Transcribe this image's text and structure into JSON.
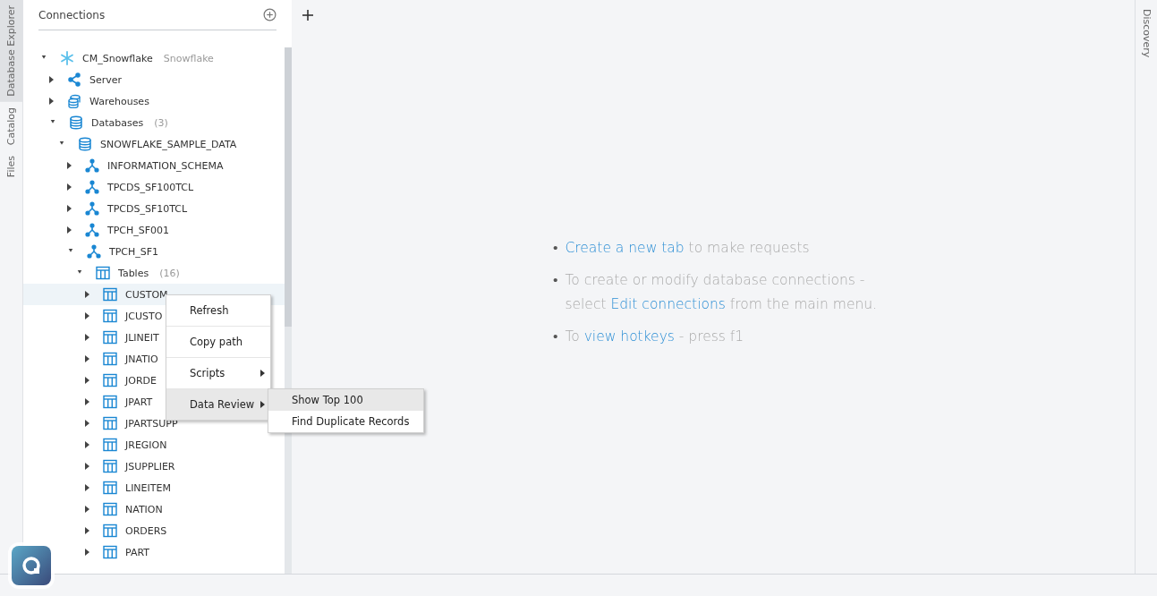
{
  "side_tabs": [
    {
      "label": "Database Explorer",
      "selected": true
    },
    {
      "label": "Catalog",
      "selected": false
    },
    {
      "label": "Files",
      "selected": false
    }
  ],
  "sidebar": {
    "title": "Connections",
    "tree": [
      {
        "kind": "connection",
        "label": "CM_Snowflake",
        "detail": "Snowflake",
        "expanded": true,
        "selected": false,
        "children": [
          {
            "kind": "server",
            "label": "Server",
            "expanded": false,
            "selected": false
          },
          {
            "kind": "warehouses",
            "label": "Warehouses",
            "expanded": false,
            "selected": false
          },
          {
            "kind": "database",
            "label": "Databases",
            "count": "(3)",
            "expanded": true,
            "selected": false,
            "children": [
              {
                "kind": "database",
                "label": "SNOWFLAKE_SAMPLE_DATA",
                "expanded": true,
                "selected": false,
                "children": [
                  {
                    "kind": "schema",
                    "label": "INFORMATION_SCHEMA",
                    "expanded": false,
                    "selected": false
                  },
                  {
                    "kind": "schema",
                    "label": "TPCDS_SF100TCL",
                    "expanded": false,
                    "selected": false
                  },
                  {
                    "kind": "schema",
                    "label": "TPCDS_SF10TCL",
                    "expanded": false,
                    "selected": false
                  },
                  {
                    "kind": "schema",
                    "label": "TPCH_SF001",
                    "expanded": false,
                    "selected": false
                  },
                  {
                    "kind": "schema",
                    "label": "TPCH_SF1",
                    "expanded": true,
                    "selected": false,
                    "children": [
                      {
                        "kind": "table",
                        "label": "Tables",
                        "count": "(16)",
                        "expanded": true,
                        "selected": false,
                        "children": [
                          {
                            "kind": "table",
                            "label": "CUSTOM",
                            "expanded": false,
                            "selected": true
                          },
                          {
                            "kind": "table",
                            "label": "JCUSTO",
                            "expanded": false,
                            "selected": false
                          },
                          {
                            "kind": "table",
                            "label": "JLINEIT",
                            "expanded": false,
                            "selected": false
                          },
                          {
                            "kind": "table",
                            "label": "JNATIO",
                            "expanded": false,
                            "selected": false
                          },
                          {
                            "kind": "table",
                            "label": "JORDE",
                            "expanded": false,
                            "selected": false
                          },
                          {
                            "kind": "table",
                            "label": "JPART",
                            "expanded": false,
                            "selected": false
                          },
                          {
                            "kind": "table",
                            "label": "JPARTSUPP",
                            "expanded": false,
                            "selected": false
                          },
                          {
                            "kind": "table",
                            "label": "JREGION",
                            "expanded": false,
                            "selected": false
                          },
                          {
                            "kind": "table",
                            "label": "JSUPPLIER",
                            "expanded": false,
                            "selected": false
                          },
                          {
                            "kind": "table",
                            "label": "LINEITEM",
                            "expanded": false,
                            "selected": false
                          },
                          {
                            "kind": "table",
                            "label": "NATION",
                            "expanded": false,
                            "selected": false
                          },
                          {
                            "kind": "table",
                            "label": "ORDERS",
                            "expanded": false,
                            "selected": false
                          },
                          {
                            "kind": "table",
                            "label": "PART",
                            "expanded": false,
                            "selected": false
                          }
                        ]
                      }
                    ]
                  }
                ]
              }
            ]
          }
        ]
      }
    ]
  },
  "context_menu": {
    "items": [
      {
        "label": "Refresh",
        "has_submenu": false,
        "selected": false
      },
      {
        "label": "Copy path",
        "has_submenu": false,
        "selected": false
      },
      {
        "label": "Scripts",
        "has_submenu": true,
        "selected": false
      },
      {
        "label": "Data Review",
        "has_submenu": true,
        "selected": true
      }
    ],
    "submenu": [
      {
        "label": "Show Top 100",
        "selected": true
      },
      {
        "label": "Find Duplicate Records",
        "selected": false
      }
    ]
  },
  "tips": [
    {
      "marker": "•",
      "parts": [
        {
          "text": "Create a new tab",
          "link": true
        },
        {
          "text": " to make requests",
          "link": false
        }
      ]
    },
    {
      "marker": "•",
      "parts": [
        {
          "text": "To create or modify database connections - select ",
          "link": false
        },
        {
          "text": "Edit connections",
          "link": true
        },
        {
          "text": " from the main menu.",
          "link": false
        }
      ]
    },
    {
      "marker": "•",
      "parts": [
        {
          "text": "To ",
          "link": false
        },
        {
          "text": "view hotkeys",
          "link": true
        },
        {
          "text": " - press f1",
          "link": false
        }
      ]
    }
  ],
  "right_tabs": [
    {
      "label": "Discovery",
      "selected": false
    }
  ]
}
